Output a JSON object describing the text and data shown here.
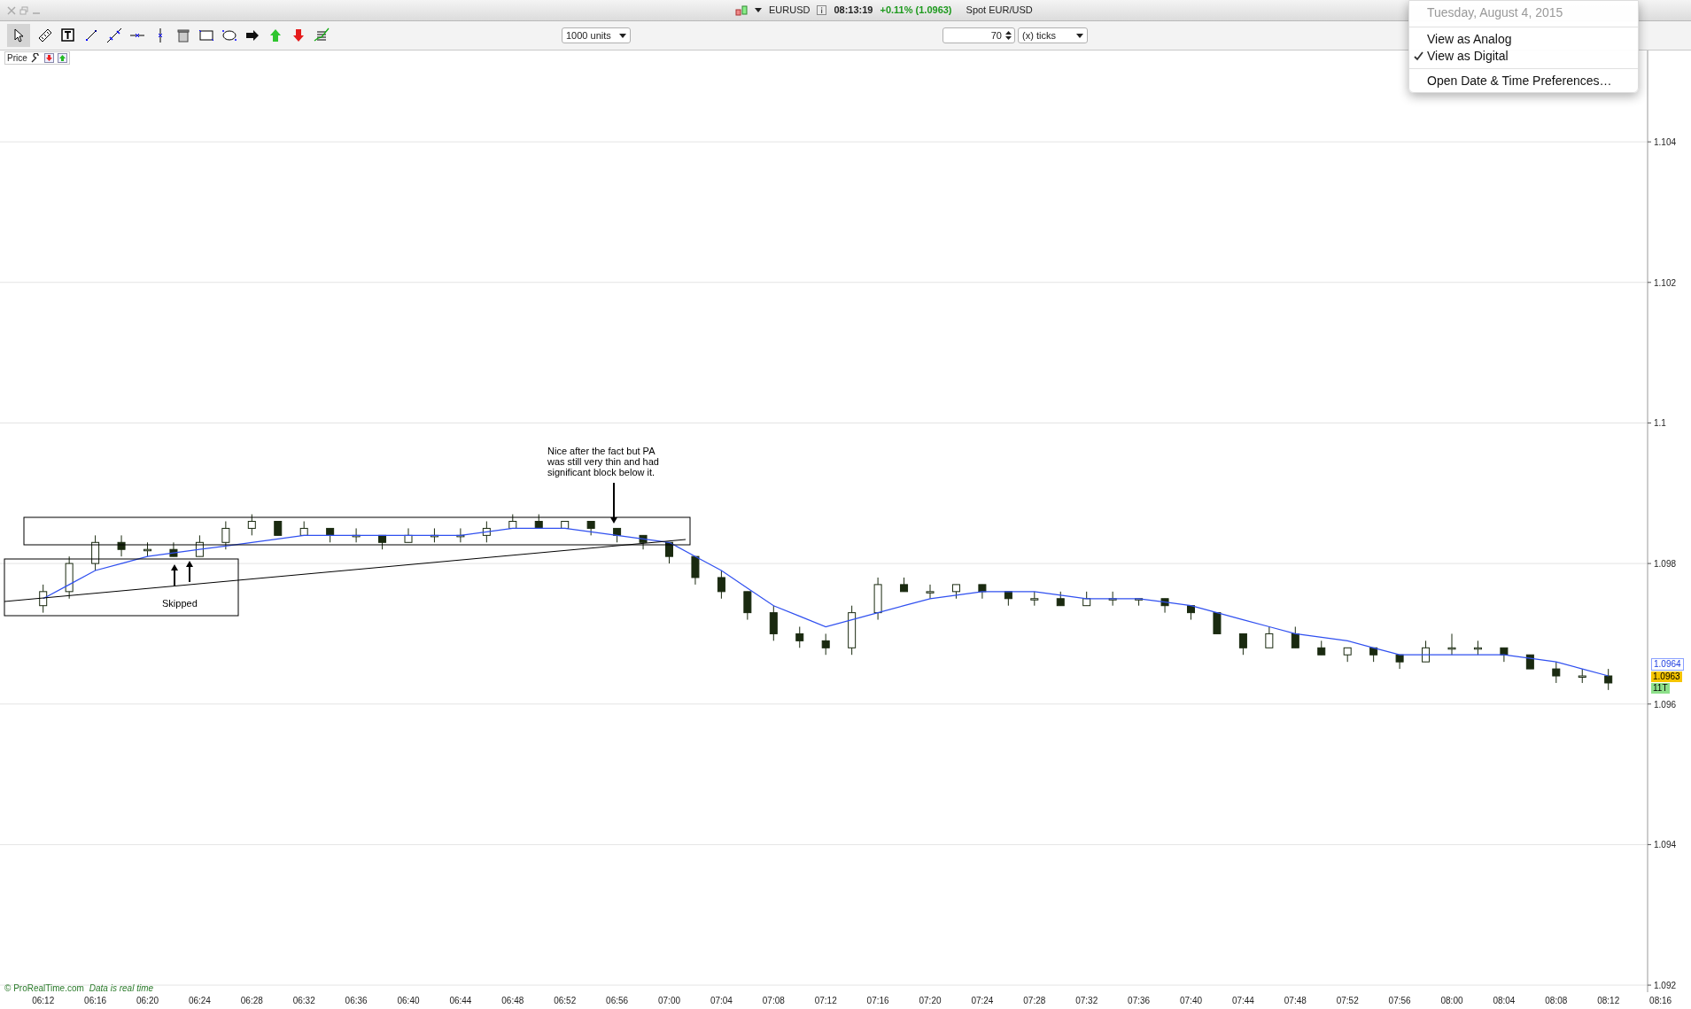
{
  "window": {
    "symbol": "EURUSD",
    "time": "08:13:19",
    "change": "+0.11% (1.0963)",
    "instrument": "Spot EUR/USD"
  },
  "toolbar": {
    "quantity": "1000 units",
    "period_count": "70",
    "period_unit": "(x) ticks"
  },
  "pane": {
    "title": "Price"
  },
  "clock_menu": {
    "date": "Tuesday, August 4, 2015",
    "items": [
      {
        "label": "View as Analog",
        "checked": false
      },
      {
        "label": "View as Digital",
        "checked": true
      },
      {
        "label": "Open Date & Time Preferences…",
        "checked": false
      }
    ]
  },
  "price_tags": [
    {
      "kind": "average",
      "label": "1.0964"
    },
    {
      "kind": "last",
      "label": "1.0963"
    },
    {
      "kind": "ticks",
      "label": "11T"
    }
  ],
  "footer": {
    "copyright": "© ProRealTime.com",
    "note": "Data is real time"
  },
  "chart_data": {
    "type": "candlestick",
    "grid": true,
    "ylim": [
      1.0919,
      1.1053
    ],
    "categories": [
      "06:12",
      null,
      "06:16",
      null,
      "06:20",
      null,
      "06:24",
      null,
      "06:28",
      null,
      "06:32",
      null,
      "06:36",
      null,
      "06:40",
      null,
      "06:44",
      null,
      "06:48",
      null,
      "06:52",
      null,
      "06:56",
      null,
      "07:00",
      null,
      "07:04",
      null,
      "07:08",
      null,
      "07:12",
      null,
      "07:16",
      null,
      "07:20",
      null,
      "07:24",
      null,
      "07:28",
      null,
      "07:32",
      null,
      "07:36",
      null,
      "07:40",
      null,
      "07:44",
      null,
      "07:48",
      null,
      "07:52",
      null,
      "07:56",
      null,
      "08:00",
      null,
      "08:04",
      null,
      "08:08",
      null,
      "08:12",
      null,
      "08:16"
    ],
    "ohlc": [
      [
        1.0974,
        1.0977,
        1.0973,
        1.0976
      ],
      [
        1.0976,
        1.0981,
        1.0975,
        1.098
      ],
      [
        1.098,
        1.0984,
        1.0979,
        1.0983
      ],
      [
        1.0983,
        1.0984,
        1.0981,
        1.0982
      ],
      [
        1.0982,
        1.0983,
        1.0981,
        1.0982
      ],
      [
        1.0982,
        1.0983,
        1.0981,
        1.0981
      ],
      [
        1.0981,
        1.0984,
        1.0981,
        1.0983
      ],
      [
        1.0983,
        1.0986,
        1.0982,
        1.0985
      ],
      [
        1.0985,
        1.0987,
        1.0984,
        1.0986
      ],
      [
        1.0986,
        1.0986,
        1.0984,
        1.0984
      ],
      [
        1.0984,
        1.0986,
        1.0984,
        1.0985
      ],
      [
        1.0985,
        1.0985,
        1.0983,
        1.0984
      ],
      [
        1.0984,
        1.0985,
        1.0983,
        1.0984
      ],
      [
        1.0984,
        1.0984,
        1.0982,
        1.0983
      ],
      [
        1.0983,
        1.0985,
        1.0983,
        1.0984
      ],
      [
        1.0984,
        1.0985,
        1.0983,
        1.0984
      ],
      [
        1.0984,
        1.0985,
        1.0983,
        1.0984
      ],
      [
        1.0984,
        1.0986,
        1.0983,
        1.0985
      ],
      [
        1.0985,
        1.0987,
        1.0985,
        1.0986
      ],
      [
        1.0986,
        1.0987,
        1.0985,
        1.0985
      ],
      [
        1.0985,
        1.0986,
        1.0985,
        1.0986
      ],
      [
        1.0986,
        1.0986,
        1.0984,
        1.0985
      ],
      [
        1.0985,
        1.0985,
        1.0983,
        1.0984
      ],
      [
        1.0984,
        1.0984,
        1.0982,
        1.0983
      ],
      [
        1.0983,
        1.0983,
        1.098,
        1.0981
      ],
      [
        1.0981,
        1.0981,
        1.0977,
        1.0978
      ],
      [
        1.0978,
        1.0979,
        1.0975,
        1.0976
      ],
      [
        1.0976,
        1.0976,
        1.0972,
        1.0973
      ],
      [
        1.0973,
        1.0974,
        1.0969,
        1.097
      ],
      [
        1.097,
        1.0971,
        1.0968,
        1.0969
      ],
      [
        1.0969,
        1.097,
        1.0967,
        1.0968
      ],
      [
        1.0968,
        1.0974,
        1.0967,
        1.0973
      ],
      [
        1.0973,
        1.0978,
        1.0972,
        1.0977
      ],
      [
        1.0977,
        1.0978,
        1.0976,
        1.0976
      ],
      [
        1.0976,
        1.0977,
        1.0975,
        1.0976
      ],
      [
        1.0976,
        1.0977,
        1.0975,
        1.0977
      ],
      [
        1.0977,
        1.0977,
        1.0975,
        1.0976
      ],
      [
        1.0976,
        1.0976,
        1.0974,
        1.0975
      ],
      [
        1.0975,
        1.0976,
        1.0974,
        1.0975
      ],
      [
        1.0975,
        1.0976,
        1.0974,
        1.0974
      ],
      [
        1.0974,
        1.0976,
        1.0974,
        1.0975
      ],
      [
        1.0975,
        1.0976,
        1.0974,
        1.0975
      ],
      [
        1.0975,
        1.0975,
        1.0974,
        1.0975
      ],
      [
        1.0975,
        1.0975,
        1.0973,
        1.0974
      ],
      [
        1.0974,
        1.0974,
        1.0972,
        1.0973
      ],
      [
        1.0973,
        1.0973,
        1.097,
        1.097
      ],
      [
        1.097,
        1.097,
        1.0967,
        1.0968
      ],
      [
        1.0968,
        1.0971,
        1.0968,
        1.097
      ],
      [
        1.097,
        1.0971,
        1.0968,
        1.0968
      ],
      [
        1.0968,
        1.0969,
        1.0967,
        1.0967
      ],
      [
        1.0967,
        1.0968,
        1.0966,
        1.0968
      ],
      [
        1.0968,
        1.0968,
        1.0966,
        1.0967
      ],
      [
        1.0967,
        1.0967,
        1.0965,
        1.0966
      ],
      [
        1.0966,
        1.0969,
        1.0966,
        1.0968
      ],
      [
        1.0968,
        1.097,
        1.0967,
        1.0968
      ],
      [
        1.0968,
        1.0969,
        1.0967,
        1.0968
      ],
      [
        1.0968,
        1.0968,
        1.0966,
        1.0967
      ],
      [
        1.0967,
        1.0967,
        1.0965,
        1.0965
      ],
      [
        1.0965,
        1.0966,
        1.0963,
        1.0964
      ],
      [
        1.0964,
        1.0965,
        1.0963,
        1.0964
      ],
      [
        1.0964,
        1.0965,
        1.0962,
        1.0963
      ],
      null,
      null
    ],
    "series": [
      {
        "type": "line",
        "color": "#3050f0",
        "values": [
          1.0975,
          1.0977,
          1.0979,
          1.098,
          1.0981,
          1.09815,
          1.0982,
          1.09825,
          1.0983,
          1.09835,
          1.0984,
          1.0984,
          1.0984,
          1.0984,
          1.0984,
          1.0984,
          1.0984,
          1.09845,
          1.0985,
          1.0985,
          1.0985,
          1.09845,
          1.0984,
          1.09835,
          1.0983,
          1.0981,
          1.0979,
          1.09765,
          1.0974,
          1.09725,
          1.0971,
          1.0972,
          1.0973,
          1.0974,
          1.0975,
          1.09755,
          1.0976,
          1.0976,
          1.0976,
          1.09755,
          1.0975,
          1.0975,
          1.0975,
          1.09745,
          1.0974,
          1.0973,
          1.0972,
          1.0971,
          1.097,
          1.09695,
          1.0969,
          1.0968,
          1.0967,
          1.0967,
          1.0967,
          1.0967,
          1.0967,
          1.09665,
          1.0966,
          1.0965,
          1.0964,
          null,
          null
        ]
      }
    ],
    "yticks": [
      {
        "value": 1.104,
        "label": "1.104"
      },
      {
        "value": 1.102,
        "label": "1.102"
      },
      {
        "value": 1.1,
        "label": "1.1"
      },
      {
        "value": 1.098,
        "label": "1.098"
      },
      {
        "value": 1.096,
        "label": "1.096"
      },
      {
        "value": 1.094,
        "label": "1.094"
      },
      {
        "value": 1.092,
        "label": "1.092"
      }
    ]
  },
  "annotations": [
    {
      "kind": "note",
      "lines": [
        "Nice after the fact but PA",
        "was still very thin and had",
        "significant block below it."
      ]
    },
    {
      "kind": "label",
      "lines": [
        "Skipped"
      ]
    }
  ]
}
